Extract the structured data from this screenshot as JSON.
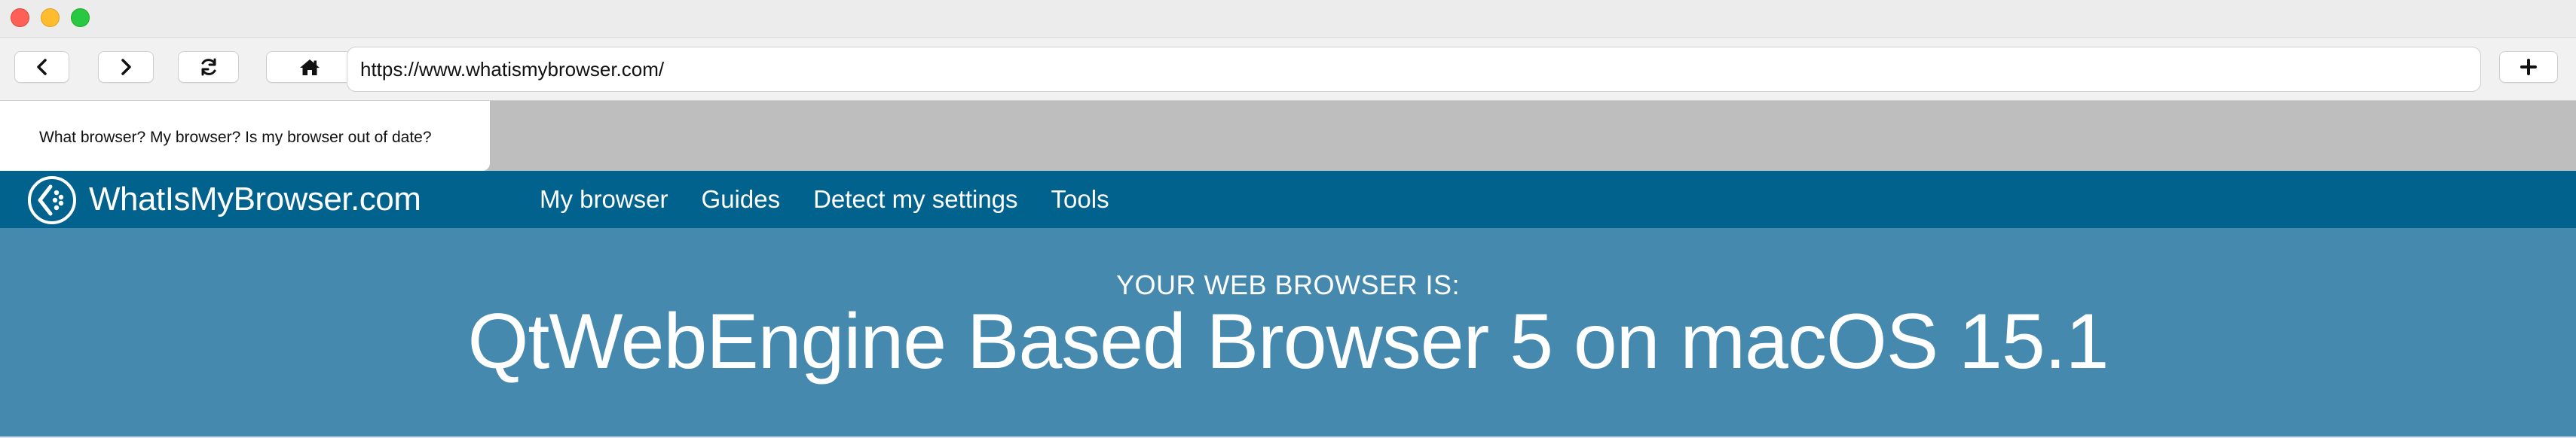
{
  "window": {
    "controls": [
      "close",
      "minimize",
      "maximize"
    ]
  },
  "toolbar": {
    "back_icon": "chevron-left-icon",
    "forward_icon": "chevron-right-icon",
    "reload_icon": "reload-icon",
    "home_icon": "home-icon",
    "new_tab_icon": "plus-icon",
    "url": "https://www.whatismybrowser.com/"
  },
  "tabs": [
    {
      "title": "What browser? My browser? Is my browser out of date?",
      "active": true
    }
  ],
  "site": {
    "logo_text": "WhatIsMyBrowser.com",
    "nav": [
      "My browser",
      "Guides",
      "Detect my settings",
      "Tools"
    ],
    "hero_kicker": "YOUR WEB BROWSER IS:",
    "hero_title": "QtWebEngine Based Browser 5 on macOS 15.1"
  },
  "colors": {
    "nav_bg": "#01628d",
    "hero_bg": "#4689af",
    "tabstrip_bg": "#bebebe"
  }
}
